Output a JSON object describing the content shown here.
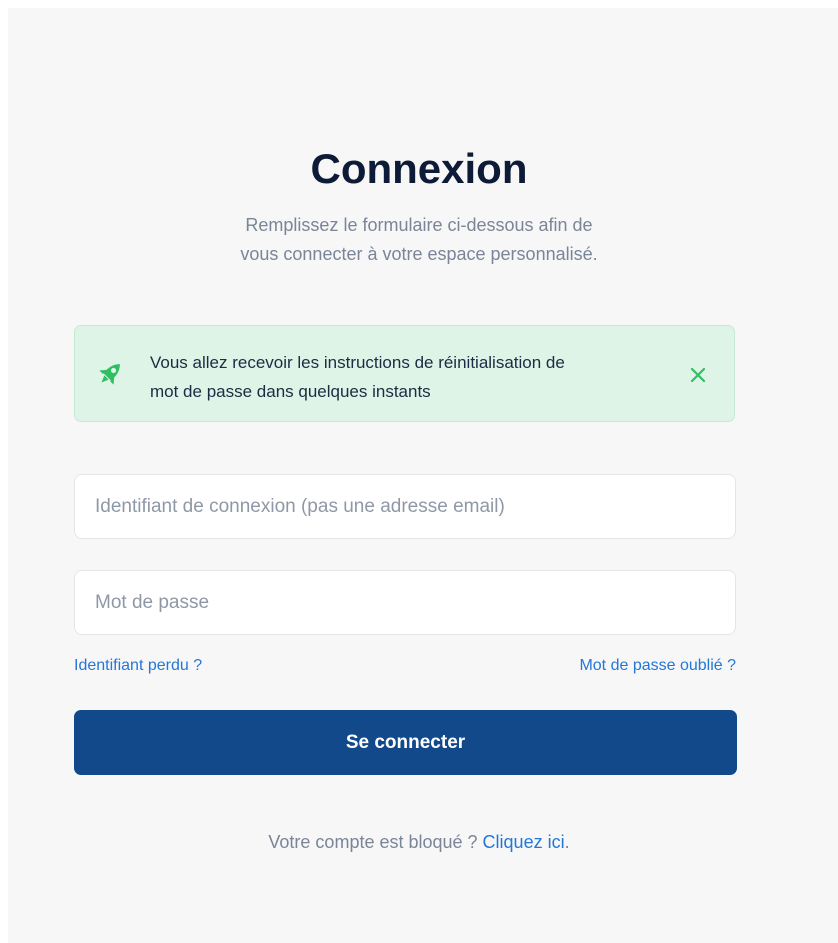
{
  "header": {
    "title": "Connexion",
    "subtitle_line1": "Remplissez le formulaire ci-dessous afin de",
    "subtitle_line2": "vous connecter à votre espace personnalisé."
  },
  "alert": {
    "icon": "rocket-icon",
    "line1": "Vous allez recevoir les instructions de réinitialisation de",
    "line2": "mot de passe dans quelques instants",
    "close_icon": "close-icon",
    "color": "#ddf4e6",
    "icon_color": "#2fbf63"
  },
  "form": {
    "login_placeholder": "Identifiant de connexion (pas une adresse email)",
    "login_value": "",
    "password_placeholder": "Mot de passe",
    "password_value": "",
    "lost_login_link": "Identifiant perdu ?",
    "forgot_password_link": "Mot de passe oublié ?",
    "submit_label": "Se connecter",
    "submit_color": "#12498a",
    "link_color": "#2377d6"
  },
  "footer": {
    "blocked_text": "Votre compte est bloqué ? ",
    "blocked_link": "Cliquez ici",
    "blocked_suffix": "."
  }
}
